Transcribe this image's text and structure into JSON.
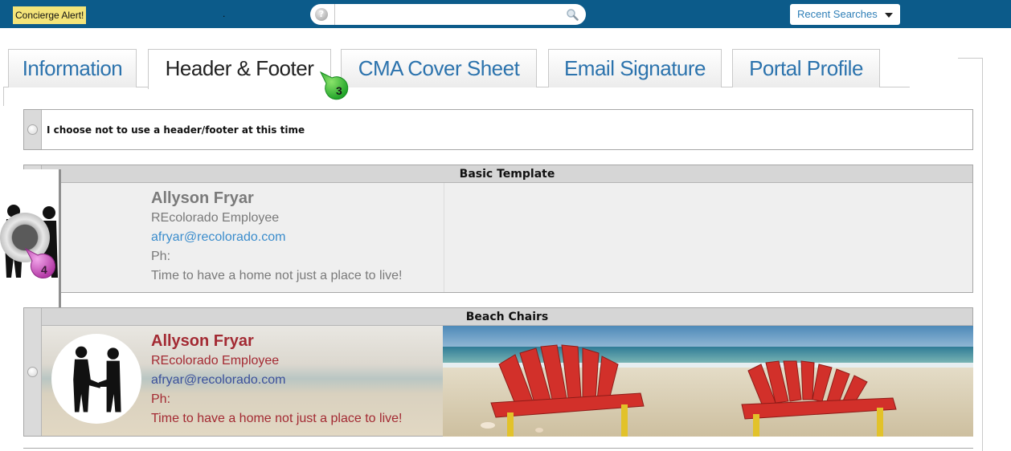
{
  "topbar": {
    "concierge_label": "Concierge Alert!",
    "trailing_text": ".",
    "search": {
      "placeholder": "",
      "help_icon": "?"
    },
    "recent_searches_label": "Recent Searches"
  },
  "tabs": [
    {
      "label": "Information",
      "active": false
    },
    {
      "label": "Header & Footer",
      "active": true
    },
    {
      "label": "CMA Cover Sheet",
      "active": false
    },
    {
      "label": "Email Signature",
      "active": false
    },
    {
      "label": "Portal Profile",
      "active": false
    }
  ],
  "callouts": {
    "step3": "3",
    "step4": "4"
  },
  "options": {
    "none_label": "I choose not to use a header/footer at this time",
    "templates": [
      {
        "title": "Basic Template",
        "name": "Allyson Fryar",
        "role": "REcolorado Employee",
        "email": "afryar@recolorado.com",
        "phone": "Ph:",
        "tagline": "Time to have a home not just a place to live!"
      },
      {
        "title": "Beach Chairs",
        "name": "Allyson Fryar",
        "role": "REcolorado Employee",
        "email": "afryar@recolorado.com",
        "phone": "Ph:",
        "tagline": "Time to have a home not just a place to live!"
      }
    ]
  },
  "colors": {
    "topbar": "#0c5b8a",
    "tab_text": "#2c73ad",
    "badge_green": "#3cbf3c",
    "badge_purple": "#c24fb8",
    "beach_text": "#a32a33"
  }
}
